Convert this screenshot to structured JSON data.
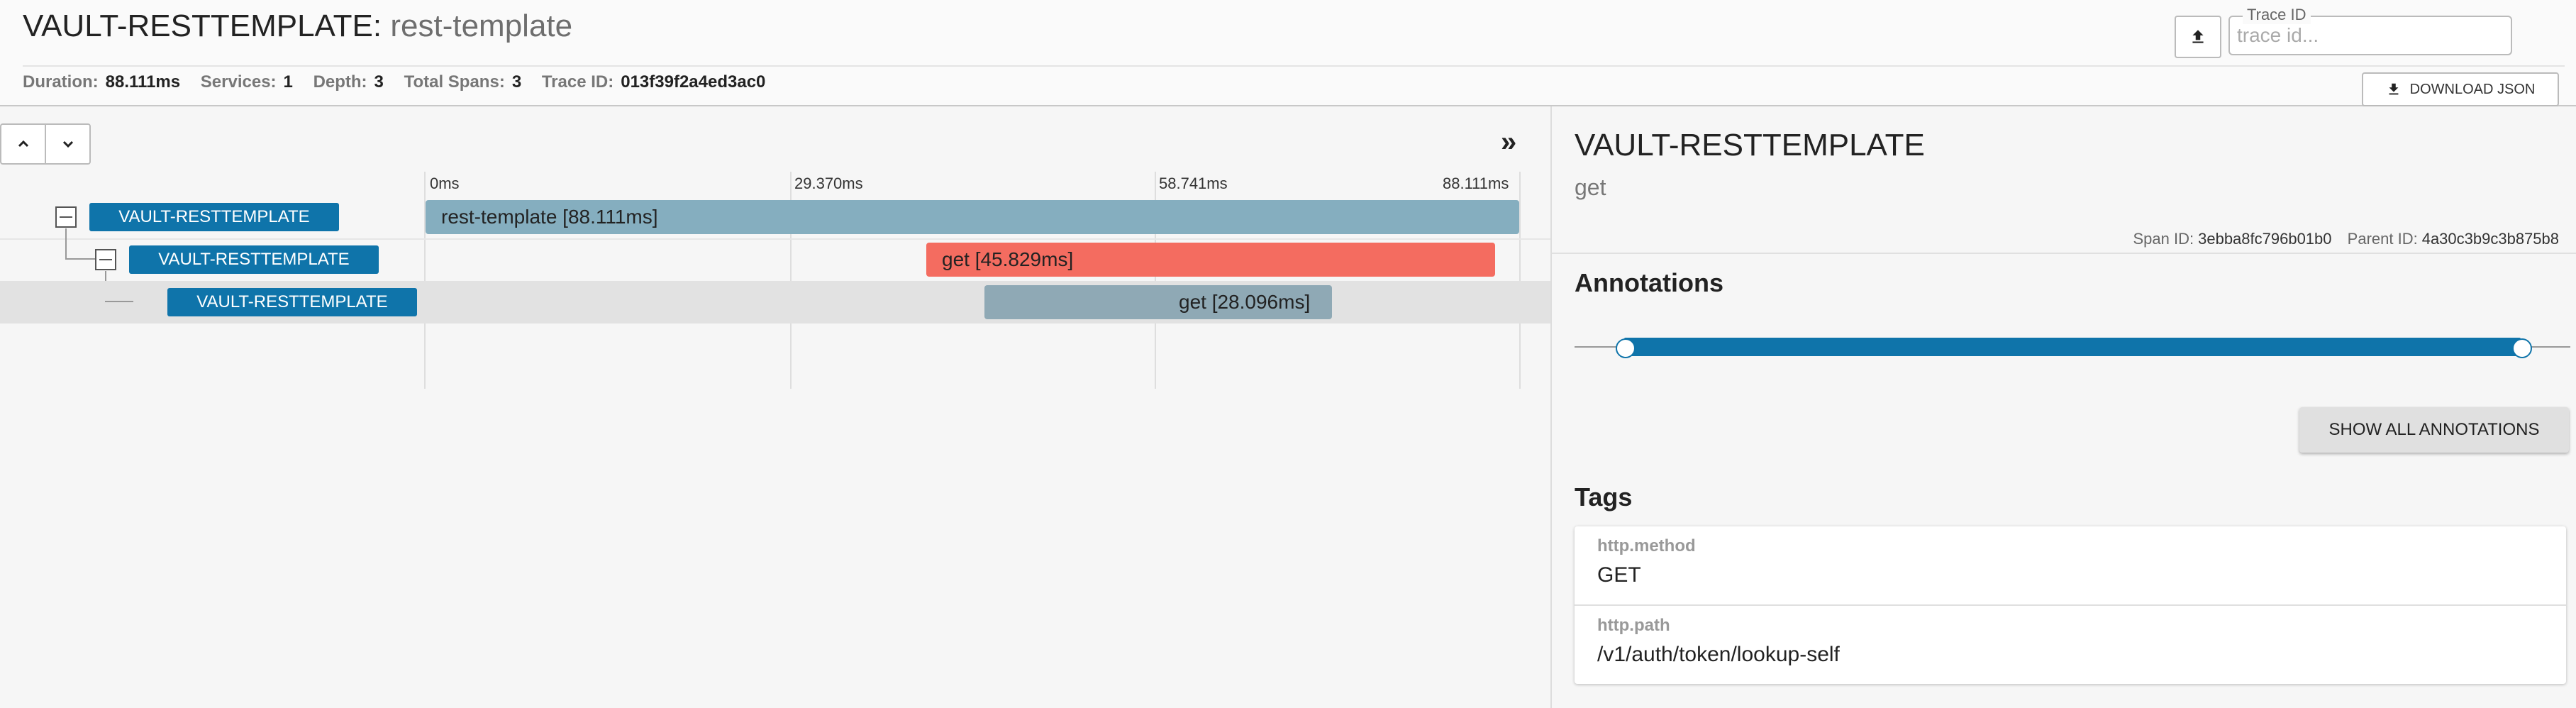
{
  "header": {
    "service_name": "VAULT-RESTTEMPLATE",
    "separator": ":",
    "span_name": "rest-template",
    "stats": {
      "duration_label": "Duration:",
      "duration_value": "88.111ms",
      "services_label": "Services:",
      "services_value": "1",
      "depth_label": "Depth:",
      "depth_value": "3",
      "total_spans_label": "Total Spans:",
      "total_spans_value": "3",
      "trace_id_label": "Trace ID:",
      "trace_id_value": "013f39f2a4ed3ac0"
    },
    "trace_id_field": {
      "label": "Trace ID",
      "placeholder": "trace id..."
    },
    "download_label": "DOWNLOAD JSON"
  },
  "timeline": {
    "ticks": [
      "0ms",
      "29.370ms",
      "58.741ms",
      "88.111ms"
    ],
    "spans": [
      {
        "service": "VAULT-RESTTEMPLATE",
        "label": "rest-template [88.111ms]"
      },
      {
        "service": "VAULT-RESTTEMPLATE",
        "label": "get [45.829ms]"
      },
      {
        "service": "VAULT-RESTTEMPLATE",
        "label": "get [28.096ms]"
      }
    ]
  },
  "detail": {
    "service": "VAULT-RESTTEMPLATE",
    "span_name": "get",
    "span_id_label": "Span ID:",
    "span_id": "3ebba8fc796b01b0",
    "parent_id_label": "Parent ID:",
    "parent_id": "4a30c3b9c3b875b8",
    "annotations_heading": "Annotations",
    "show_all_label": "SHOW ALL ANNOTATIONS",
    "tags_heading": "Tags",
    "tags": [
      {
        "key": "http.method",
        "value": "GET"
      },
      {
        "key": "http.path",
        "value": "/v1/auth/token/lookup-self"
      }
    ]
  },
  "colors": {
    "accent": "#0f74aa",
    "error": "#f46c60",
    "bar": "#85aebf"
  }
}
